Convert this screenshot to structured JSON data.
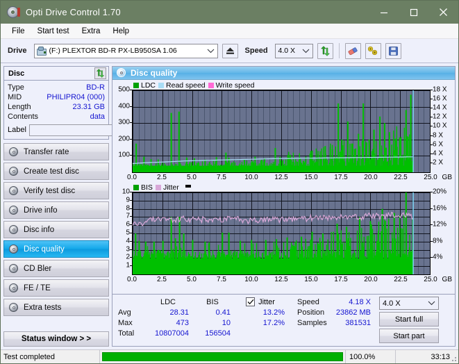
{
  "window": {
    "title": "Opti Drive Control 1.70",
    "icon": "disc-icon",
    "minimize": "–",
    "maximize": "☐",
    "close": "✕"
  },
  "menu": {
    "items": [
      {
        "label": "File"
      },
      {
        "label": "Start test"
      },
      {
        "label": "Extra"
      },
      {
        "label": "Help"
      }
    ]
  },
  "toolbar": {
    "drive_label": "Drive",
    "drive_value": "(F:)  PLEXTOR BD-R  PX-LB950SA 1.06",
    "drive_arrow": "∨",
    "eject_icon": "eject-icon",
    "speed_label": "Speed",
    "speed_value": "4.0 X",
    "speed_arrow": "∨",
    "refresh_icon": "refresh-icon",
    "erase_icon": "eraser-icon",
    "tools_icon": "tools-icon",
    "save_icon": "save-icon"
  },
  "sidebar": {
    "disc_panel": {
      "title": "Disc",
      "refresh_icon": "refresh-icon",
      "rows": [
        {
          "key": "Type",
          "value": "BD-R"
        },
        {
          "key": "MID",
          "value": "PHILIPR04 (000)"
        },
        {
          "key": "Length",
          "value": "23.31 GB"
        },
        {
          "key": "Contents",
          "value": "data"
        }
      ],
      "label_key": "Label",
      "label_value": "",
      "label_placeholder": "",
      "cd_icon": "cd-icon"
    },
    "nav": [
      {
        "label": "Transfer rate",
        "icon": "disc-icon",
        "active": false
      },
      {
        "label": "Create test disc",
        "icon": "disc-icon",
        "active": false
      },
      {
        "label": "Verify test disc",
        "icon": "disc-icon",
        "active": false
      },
      {
        "label": "Drive info",
        "icon": "disc-icon",
        "active": false
      },
      {
        "label": "Disc info",
        "icon": "disc-icon",
        "active": false
      },
      {
        "label": "Disc quality",
        "icon": "disc-icon",
        "active": true
      },
      {
        "label": "CD Bler",
        "icon": "disc-icon",
        "active": false
      },
      {
        "label": "FE / TE",
        "icon": "disc-icon",
        "active": false
      },
      {
        "label": "Extra tests",
        "icon": "disc-icon",
        "active": false
      }
    ],
    "status_window_button": "Status window > >"
  },
  "main": {
    "header_title": "Disc quality",
    "header_icon": "disc-icon"
  },
  "stats": {
    "col_ldc": "LDC",
    "col_bis": "BIS",
    "jitter_label": "Jitter",
    "jitter_checked": true,
    "check_glyph": "✓",
    "rows": [
      {
        "key": "Avg",
        "ldc": "28.31",
        "bis": "0.41",
        "jitter": "13.2%"
      },
      {
        "key": "Max",
        "ldc": "473",
        "bis": "10",
        "jitter": "17.2%"
      },
      {
        "key": "Total",
        "ldc": "10807004",
        "bis": "156504",
        "jitter": ""
      }
    ],
    "speed_key": "Speed",
    "speed_value": "4.18 X",
    "position_key": "Position",
    "position_value": "23862 MB",
    "samples_key": "Samples",
    "samples_value": "381531",
    "speed_select": "4.0 X",
    "speed_select_arrow": "∨",
    "start_full": "Start full",
    "start_part": "Start part"
  },
  "statusbar": {
    "text": "Test completed",
    "percent": "100.0%",
    "progress": 100,
    "time": "33:13"
  },
  "colors": {
    "title_bar": "#6b7f63",
    "accent_blue": "#14a8ea",
    "value_blue": "#1414d0",
    "plot_bg": "#69738f",
    "ldc_green": "#00c000",
    "read_speed": "#a8dcf5",
    "write_speed": "#f77ddc",
    "bis_green": "#00c000",
    "jitter_pink": "#d8a8d8",
    "progress_green": "#00b000",
    "panel_bg": "#eef0fb"
  },
  "chart_data": [
    {
      "type": "area",
      "id": "disc-quality-ldc",
      "title": "",
      "xlabel": "GB",
      "ylabel": "",
      "xlim": [
        0,
        25
      ],
      "xticks": [
        0.0,
        2.5,
        5.0,
        7.5,
        10.0,
        12.5,
        15.0,
        17.5,
        20.0,
        22.5,
        25.0
      ],
      "xticklabels": [
        "0.0",
        "2.5",
        "5.0",
        "7.5",
        "10.0",
        "12.5",
        "15.0",
        "17.5",
        "20.0",
        "22.5",
        "25.0"
      ],
      "x_unit": "GB",
      "ylim": [
        0,
        500
      ],
      "yticks": [
        100,
        200,
        300,
        400,
        500
      ],
      "yticklabels": [
        "100",
        "200",
        "300",
        "400",
        "500"
      ],
      "y2lim": [
        0,
        18
      ],
      "y2ticks": [
        2,
        4,
        6,
        8,
        10,
        12,
        14,
        16,
        18
      ],
      "y2ticklabels": [
        "2 X",
        "4 X",
        "6 X",
        "8 X",
        "10 X",
        "12 X",
        "14 X",
        "16 X",
        "18 X"
      ],
      "grid": true,
      "legend": [
        "LDC",
        "Read speed",
        "Write speed"
      ],
      "legend_colors": [
        "#00a000",
        "#a8dcf5",
        "#ff6ad5"
      ],
      "legend_position": "top-left",
      "data_end_gb": 23.6,
      "series": [
        {
          "name": "LDC",
          "color": "#00c000",
          "axis": "left",
          "baseline_values": [
            28,
            25,
            24,
            26,
            24,
            27,
            26,
            29,
            26,
            25,
            30,
            28,
            27,
            29,
            31,
            28,
            30,
            32,
            29,
            31,
            33,
            30,
            32,
            34,
            31,
            33,
            35,
            32,
            34,
            36,
            33,
            35,
            37,
            34,
            36,
            38,
            35,
            37,
            39,
            36,
            38,
            40,
            37,
            39,
            41,
            38,
            40,
            42,
            39,
            41,
            43,
            40,
            42,
            44,
            41,
            43,
            45,
            42,
            44,
            46,
            43,
            45,
            47,
            44,
            46,
            48,
            45,
            47,
            49,
            46
          ],
          "spikes": [
            {
              "gb": 0.3,
              "value": 175
            },
            {
              "gb": 0.95,
              "value": 95
            },
            {
              "gb": 1.55,
              "value": 80
            },
            {
              "gb": 2.15,
              "value": 78
            },
            {
              "gb": 3.25,
              "value": 362
            },
            {
              "gb": 3.9,
              "value": 370
            },
            {
              "gb": 4.55,
              "value": 90
            },
            {
              "gb": 5.2,
              "value": 85
            },
            {
              "gb": 6.1,
              "value": 78
            },
            {
              "gb": 7.05,
              "value": 92
            },
            {
              "gb": 7.85,
              "value": 120
            },
            {
              "gb": 8.1,
              "value": 88
            },
            {
              "gb": 9.4,
              "value": 76
            },
            {
              "gb": 10.3,
              "value": 95
            },
            {
              "gb": 11.1,
              "value": 86
            },
            {
              "gb": 12.0,
              "value": 148
            },
            {
              "gb": 12.4,
              "value": 94
            },
            {
              "gb": 13.2,
              "value": 90
            },
            {
              "gb": 14.1,
              "value": 84
            },
            {
              "gb": 15.0,
              "value": 130
            },
            {
              "gb": 15.6,
              "value": 110
            },
            {
              "gb": 16.2,
              "value": 160
            },
            {
              "gb": 16.8,
              "value": 140
            },
            {
              "gb": 17.3,
              "value": 420
            },
            {
              "gb": 17.6,
              "value": 200
            },
            {
              "gb": 18.1,
              "value": 310
            },
            {
              "gb": 18.5,
              "value": 175
            },
            {
              "gb": 19.0,
              "value": 235
            },
            {
              "gb": 19.4,
              "value": 420
            },
            {
              "gb": 19.9,
              "value": 200
            },
            {
              "gb": 20.3,
              "value": 260
            },
            {
              "gb": 20.8,
              "value": 340
            },
            {
              "gb": 21.2,
              "value": 300
            },
            {
              "gb": 21.6,
              "value": 245
            },
            {
              "gb": 22.1,
              "value": 205
            },
            {
              "gb": 22.5,
              "value": 210
            },
            {
              "gb": 23.0,
              "value": 380
            },
            {
              "gb": 23.4,
              "value": 473
            }
          ]
        },
        {
          "name": "Read speed",
          "color": "#a8dcf5",
          "axis": "right",
          "points": [
            {
              "gb": 0.0,
              "x_speed": 1.9
            },
            {
              "gb": 1.0,
              "x_speed": 2.1
            },
            {
              "gb": 2.0,
              "x_speed": 2.2
            },
            {
              "gb": 3.0,
              "x_speed": 2.3
            },
            {
              "gb": 4.5,
              "x_speed": 2.5
            },
            {
              "gb": 6.0,
              "x_speed": 2.6
            },
            {
              "gb": 7.5,
              "x_speed": 2.7
            },
            {
              "gb": 9.0,
              "x_speed": 2.8
            },
            {
              "gb": 10.5,
              "x_speed": 2.9
            },
            {
              "gb": 12.0,
              "x_speed": 3.0
            },
            {
              "gb": 13.5,
              "x_speed": 3.05
            },
            {
              "gb": 15.0,
              "x_speed": 3.1
            },
            {
              "gb": 16.5,
              "x_speed": 3.15
            },
            {
              "gb": 18.0,
              "x_speed": 3.2
            },
            {
              "gb": 19.5,
              "x_speed": 3.25
            },
            {
              "gb": 21.0,
              "x_speed": 3.3
            },
            {
              "gb": 22.5,
              "x_speed": 3.35
            },
            {
              "gb": 23.6,
              "x_speed": 3.4
            }
          ]
        },
        {
          "name": "Write speed",
          "color": "#ff6ad5",
          "axis": "right",
          "points": []
        }
      ]
    },
    {
      "type": "area",
      "id": "disc-quality-bis-jitter",
      "title": "",
      "xlabel": "GB",
      "ylabel": "",
      "xlim": [
        0,
        25
      ],
      "xticks": [
        0.0,
        2.5,
        5.0,
        7.5,
        10.0,
        12.5,
        15.0,
        17.5,
        20.0,
        22.5,
        25.0
      ],
      "xticklabels": [
        "0.0",
        "2.5",
        "5.0",
        "7.5",
        "10.0",
        "12.5",
        "15.0",
        "17.5",
        "20.0",
        "22.5",
        "25.0"
      ],
      "x_unit": "GB",
      "ylim": [
        0,
        10
      ],
      "yticks": [
        1,
        2,
        3,
        4,
        5,
        6,
        7,
        8,
        9,
        10
      ],
      "yticklabels": [
        "1",
        "2",
        "3",
        "4",
        "5",
        "6",
        "7",
        "8",
        "9",
        "10"
      ],
      "y2lim": [
        0,
        20
      ],
      "y2ticks": [
        4,
        8,
        12,
        16,
        20
      ],
      "y2ticklabels": [
        "4%",
        "8%",
        "12%",
        "16%",
        "20%"
      ],
      "grid": true,
      "legend": [
        "BIS",
        "Jitter"
      ],
      "legend_colors": [
        "#00a000",
        "#d8a8d8"
      ],
      "legend_position": "top-left",
      "data_end_gb": 23.6,
      "series": [
        {
          "name": "BIS",
          "color": "#00c000",
          "axis": "left",
          "baseline_avg": 2.2,
          "baseline_band": [
            1.8,
            3.0
          ],
          "max": 10,
          "spikes": [
            {
              "gb": 0.25,
              "value": 5.0
            },
            {
              "gb": 0.55,
              "value": 4.1
            },
            {
              "gb": 1.1,
              "value": 4.0
            },
            {
              "gb": 1.8,
              "value": 4.0
            },
            {
              "gb": 2.55,
              "value": 4.1
            },
            {
              "gb": 3.25,
              "value": 7.0
            },
            {
              "gb": 3.6,
              "value": 4.4
            },
            {
              "gb": 3.95,
              "value": 7.0
            },
            {
              "gb": 4.3,
              "value": 5.0
            },
            {
              "gb": 5.05,
              "value": 4.2
            },
            {
              "gb": 6.1,
              "value": 4.0
            },
            {
              "gb": 7.55,
              "value": 5.1
            },
            {
              "gb": 8.1,
              "value": 5.1
            },
            {
              "gb": 9.05,
              "value": 4.1
            },
            {
              "gb": 10.0,
              "value": 4.2
            },
            {
              "gb": 11.2,
              "value": 4.2
            },
            {
              "gb": 12.1,
              "value": 4.3
            },
            {
              "gb": 13.0,
              "value": 4.5
            },
            {
              "gb": 14.2,
              "value": 4.6
            },
            {
              "gb": 15.1,
              "value": 5.2
            },
            {
              "gb": 16.0,
              "value": 5.0
            },
            {
              "gb": 17.2,
              "value": 6.2
            },
            {
              "gb": 18.0,
              "value": 5.8
            },
            {
              "gb": 19.1,
              "value": 7.0
            },
            {
              "gb": 20.0,
              "value": 6.5
            },
            {
              "gb": 21.0,
              "value": 8.0
            },
            {
              "gb": 22.0,
              "value": 7.5
            },
            {
              "gb": 23.0,
              "value": 10.0
            }
          ]
        },
        {
          "name": "Jitter",
          "color": "#d8a8d8",
          "axis": "right",
          "percent_avg": 13.2,
          "percent_max": 17.2,
          "points": [
            {
              "gb": 0.1,
              "percent": 12.4
            },
            {
              "gb": 0.5,
              "percent": 12.3
            },
            {
              "gb": 1.0,
              "percent": 12.8
            },
            {
              "gb": 1.5,
              "percent": 13.6
            },
            {
              "gb": 2.0,
              "percent": 13.4
            },
            {
              "gb": 2.5,
              "percent": 13.8
            },
            {
              "gb": 3.0,
              "percent": 13.2
            },
            {
              "gb": 3.5,
              "percent": 13.4
            },
            {
              "gb": 4.0,
              "percent": 13.6
            },
            {
              "gb": 5.0,
              "percent": 13.3
            },
            {
              "gb": 6.0,
              "percent": 13.4
            },
            {
              "gb": 7.0,
              "percent": 13.2
            },
            {
              "gb": 8.0,
              "percent": 13.6
            },
            {
              "gb": 9.0,
              "percent": 13.4
            },
            {
              "gb": 10.0,
              "percent": 13.0
            },
            {
              "gb": 11.0,
              "percent": 13.5
            },
            {
              "gb": 12.0,
              "percent": 13.3
            },
            {
              "gb": 13.0,
              "percent": 13.6
            },
            {
              "gb": 14.0,
              "percent": 13.4
            },
            {
              "gb": 15.0,
              "percent": 13.8
            },
            {
              "gb": 16.0,
              "percent": 14.0
            },
            {
              "gb": 17.0,
              "percent": 13.6
            },
            {
              "gb": 18.0,
              "percent": 14.2
            },
            {
              "gb": 19.0,
              "percent": 13.8
            },
            {
              "gb": 20.0,
              "percent": 14.4
            },
            {
              "gb": 21.0,
              "percent": 14.0
            },
            {
              "gb": 22.0,
              "percent": 14.6
            },
            {
              "gb": 23.0,
              "percent": 14.2
            },
            {
              "gb": 23.6,
              "percent": 14.0
            }
          ]
        }
      ]
    }
  ]
}
